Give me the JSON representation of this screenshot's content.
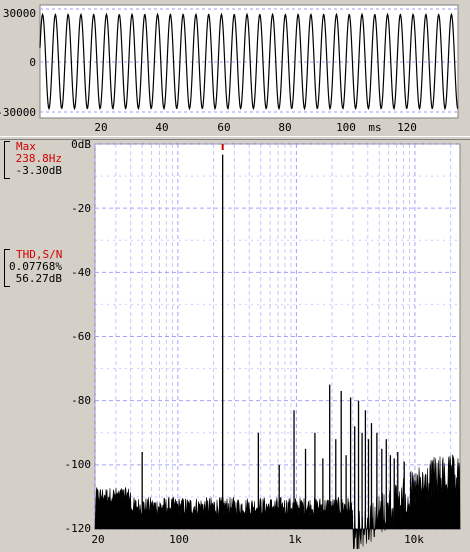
{
  "waveform": {
    "y_ticks": [
      "30000",
      "0",
      "-30000"
    ],
    "x_ticks": [
      "20",
      "40",
      "60",
      "80",
      "100",
      "120"
    ],
    "x_unit": "ms",
    "chart_data": {
      "type": "line",
      "x_range_ms": [
        0,
        137
      ],
      "y_range": [
        -36000,
        36000
      ],
      "frequency_hz": 238.8,
      "amplitude": 30000
    }
  },
  "spectrum": {
    "y_ticks": [
      "0dB",
      "-20",
      "-40",
      "-60",
      "-80",
      "-100",
      "-120"
    ],
    "x_ticks": [
      "20",
      "100",
      "1k",
      "10k"
    ],
    "chart_data": {
      "type": "line",
      "x_scale": "log",
      "xlim": [
        20,
        24000
      ],
      "ylim": [
        -120,
        0
      ],
      "grid": true,
      "peaks": [
        {
          "f": 50,
          "db": -96
        },
        {
          "f": 238.8,
          "db": -3.3
        },
        {
          "f": 477.6,
          "db": -90
        },
        {
          "f": 716.4,
          "db": -100
        },
        {
          "f": 955.2,
          "db": -83
        },
        {
          "f": 1194,
          "db": -95
        },
        {
          "f": 1433,
          "db": -90
        },
        {
          "f": 1672,
          "db": -98
        },
        {
          "f": 1910,
          "db": -75
        },
        {
          "f": 2149,
          "db": -92
        },
        {
          "f": 2388,
          "db": -77
        },
        {
          "f": 2627,
          "db": -97
        },
        {
          "f": 2866,
          "db": -79
        },
        {
          "f": 3104,
          "db": -88
        },
        {
          "f": 3343,
          "db": -80
        },
        {
          "f": 3582,
          "db": -90
        },
        {
          "f": 3821,
          "db": -83
        },
        {
          "f": 4060,
          "db": -92
        },
        {
          "f": 4299,
          "db": -87
        },
        {
          "f": 4776,
          "db": -90
        },
        {
          "f": 5254,
          "db": -95
        },
        {
          "f": 5732,
          "db": -92
        },
        {
          "f": 6209,
          "db": -97
        },
        {
          "f": 6687,
          "db": -98
        },
        {
          "f": 7165,
          "db": -96
        },
        {
          "f": 8120,
          "db": -99
        }
      ]
    }
  },
  "max_readout": {
    "title": "Max",
    "freq": "238.8Hz",
    "level": "-3.30dB"
  },
  "thd_readout": {
    "title": "THD,S/N",
    "thd": "0.07768%",
    "sn": "56.27dB"
  },
  "colors": {
    "background": "#d4d0c8",
    "plot_bg": "#ffffff",
    "grid": "#8c8cff",
    "trace": "#000000",
    "marker": "#d00000",
    "label_red": "#d00000"
  }
}
